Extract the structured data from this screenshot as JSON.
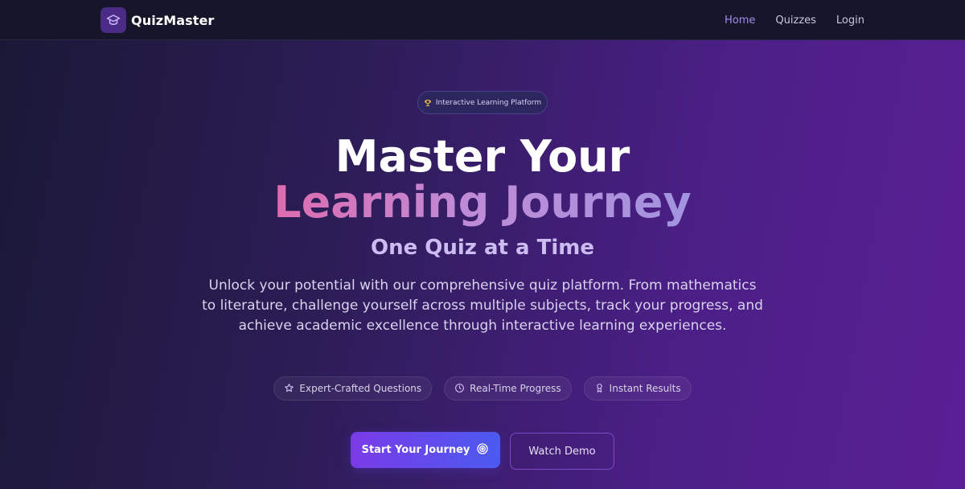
{
  "navbar": {
    "brand_name": "QuizMaster",
    "brand_icon": "graduation-cap-icon",
    "links": [
      {
        "label": "Home",
        "active": true
      },
      {
        "label": "Quizzes",
        "active": false
      },
      {
        "label": "Login",
        "active": false
      }
    ]
  },
  "hero": {
    "badge": {
      "label": "Interactive Learning Platform",
      "icon": "trophy-icon"
    },
    "title_line1": "Master Your",
    "title_line2": "Learning Journey",
    "subtitle": "One Quiz at a Time",
    "description": "Unlock your potential with our comprehensive quiz platform. From mathematics to literature, challenge yourself across multiple subjects, track your progress, and achieve academic excellence through interactive learning experiences.",
    "features": [
      {
        "label": "Expert-Crafted Questions",
        "icon": "star-icon"
      },
      {
        "label": "Real-Time Progress",
        "icon": "clock-icon"
      },
      {
        "label": "Instant Results",
        "icon": "award-icon"
      }
    ],
    "primary_button": {
      "label": "Start Your Journey",
      "icon": "target-icon"
    },
    "secondary_button": {
      "label": "Watch Demo"
    }
  },
  "colors": {
    "accent": "#a08ee8",
    "primary_gradient_start": "#7a3be7",
    "primary_gradient_end": "#4b5af0",
    "title_gradient_start": "#e06aae",
    "title_gradient_end": "#a294e0"
  }
}
